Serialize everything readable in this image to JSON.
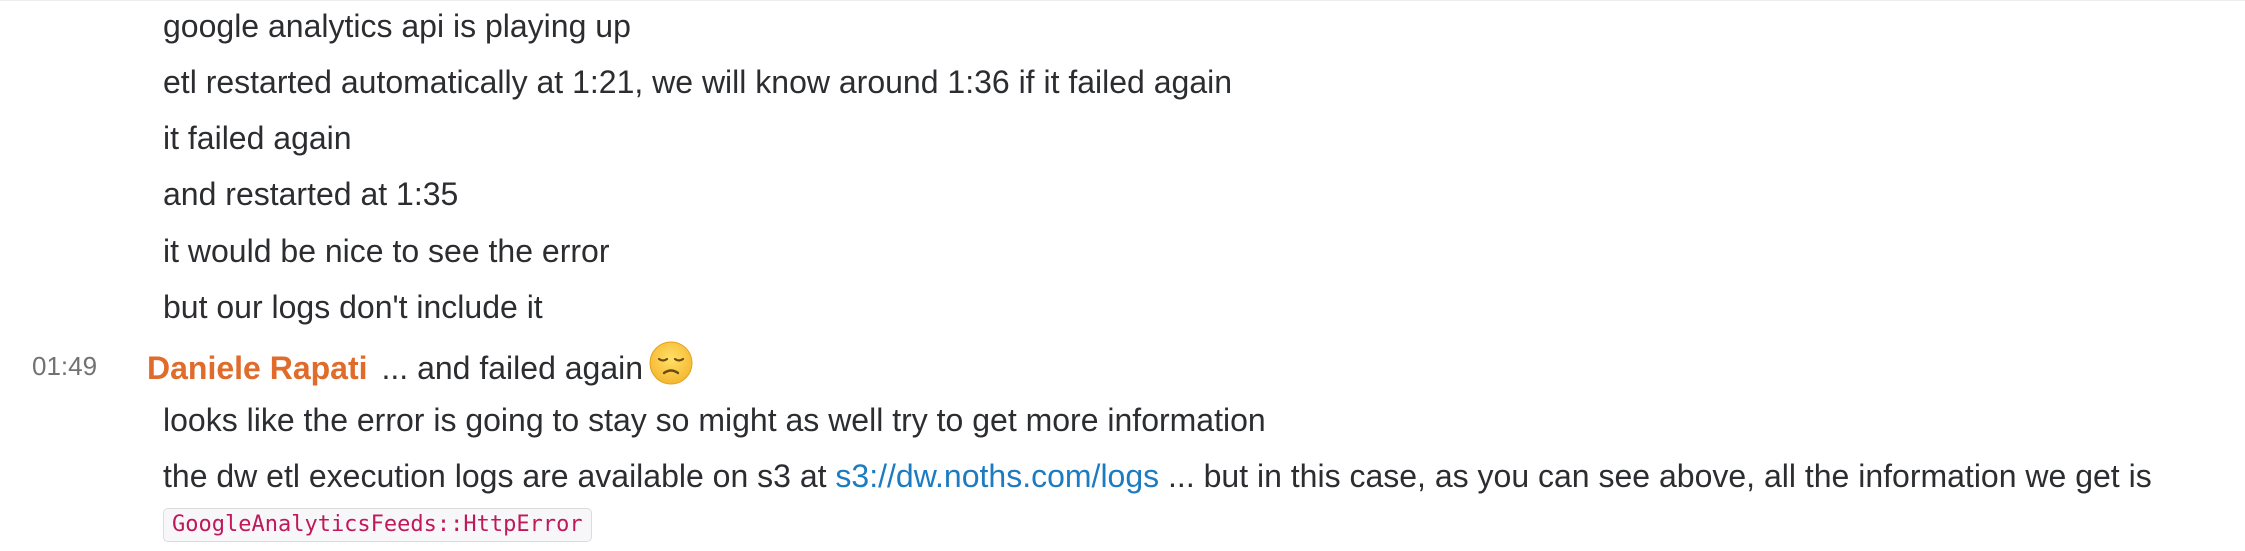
{
  "messages": {
    "previous_lines": [
      "google analytics api is playing up",
      "etl restarted automatically at 1:21, we will know around 1:36 if it failed again",
      "it failed again",
      "and restarted at 1:35",
      "it would be nice to see the error",
      "but our logs don't include it"
    ],
    "group": {
      "timestamp": "01:49",
      "sender": "Daniele Rapati",
      "first_text": "... and failed again",
      "emoji": "disappointed-face-icon",
      "line_2": "looks like the error is going to stay so might as well try to get more information",
      "line_3_prefix": "the dw etl execution logs are available on s3 at ",
      "line_3_link": "s3://dw.noths.com/logs",
      "line_3_suffix": " ... but in this case, as you can see above, all the information we get is",
      "code": "GoogleAnalyticsFeeds::HttpError"
    }
  },
  "colors": {
    "sender": "#e06b2a",
    "link": "#1d7cc1",
    "code_text": "#c0185a",
    "text": "#2c2d30",
    "timestamp": "#717274"
  }
}
